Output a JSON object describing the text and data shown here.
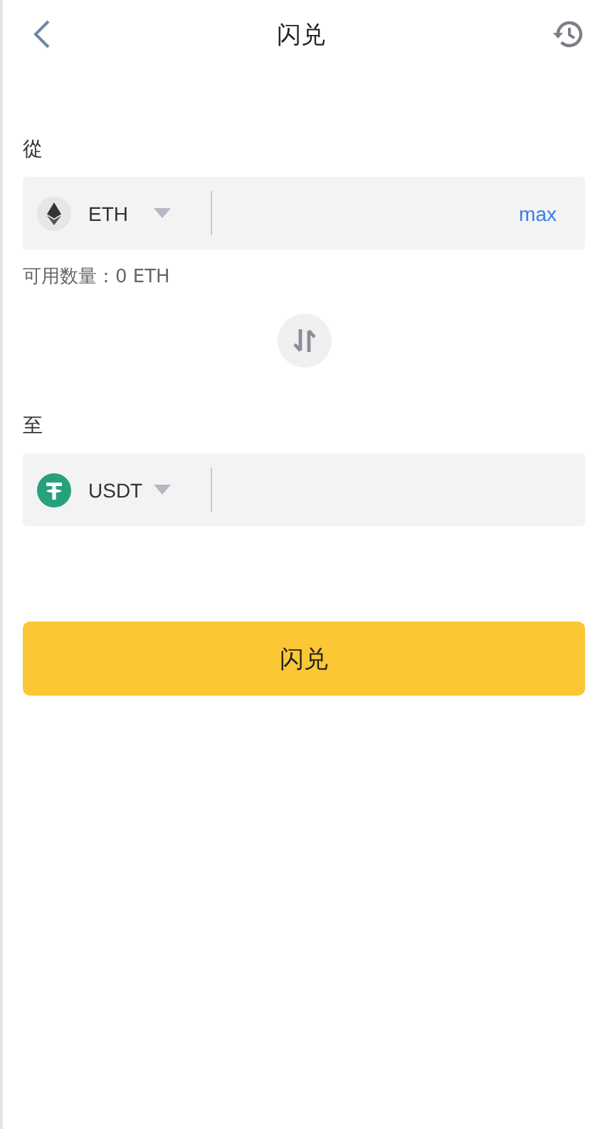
{
  "header": {
    "title": "闪兑"
  },
  "from": {
    "label": "從",
    "token": {
      "kind": "eth",
      "symbol": "ETH"
    },
    "max": "max",
    "available": "可用数量：0 ETH"
  },
  "to": {
    "label": "至",
    "token": {
      "kind": "usdt",
      "symbol": "USDT"
    }
  },
  "submit": "闪兑"
}
